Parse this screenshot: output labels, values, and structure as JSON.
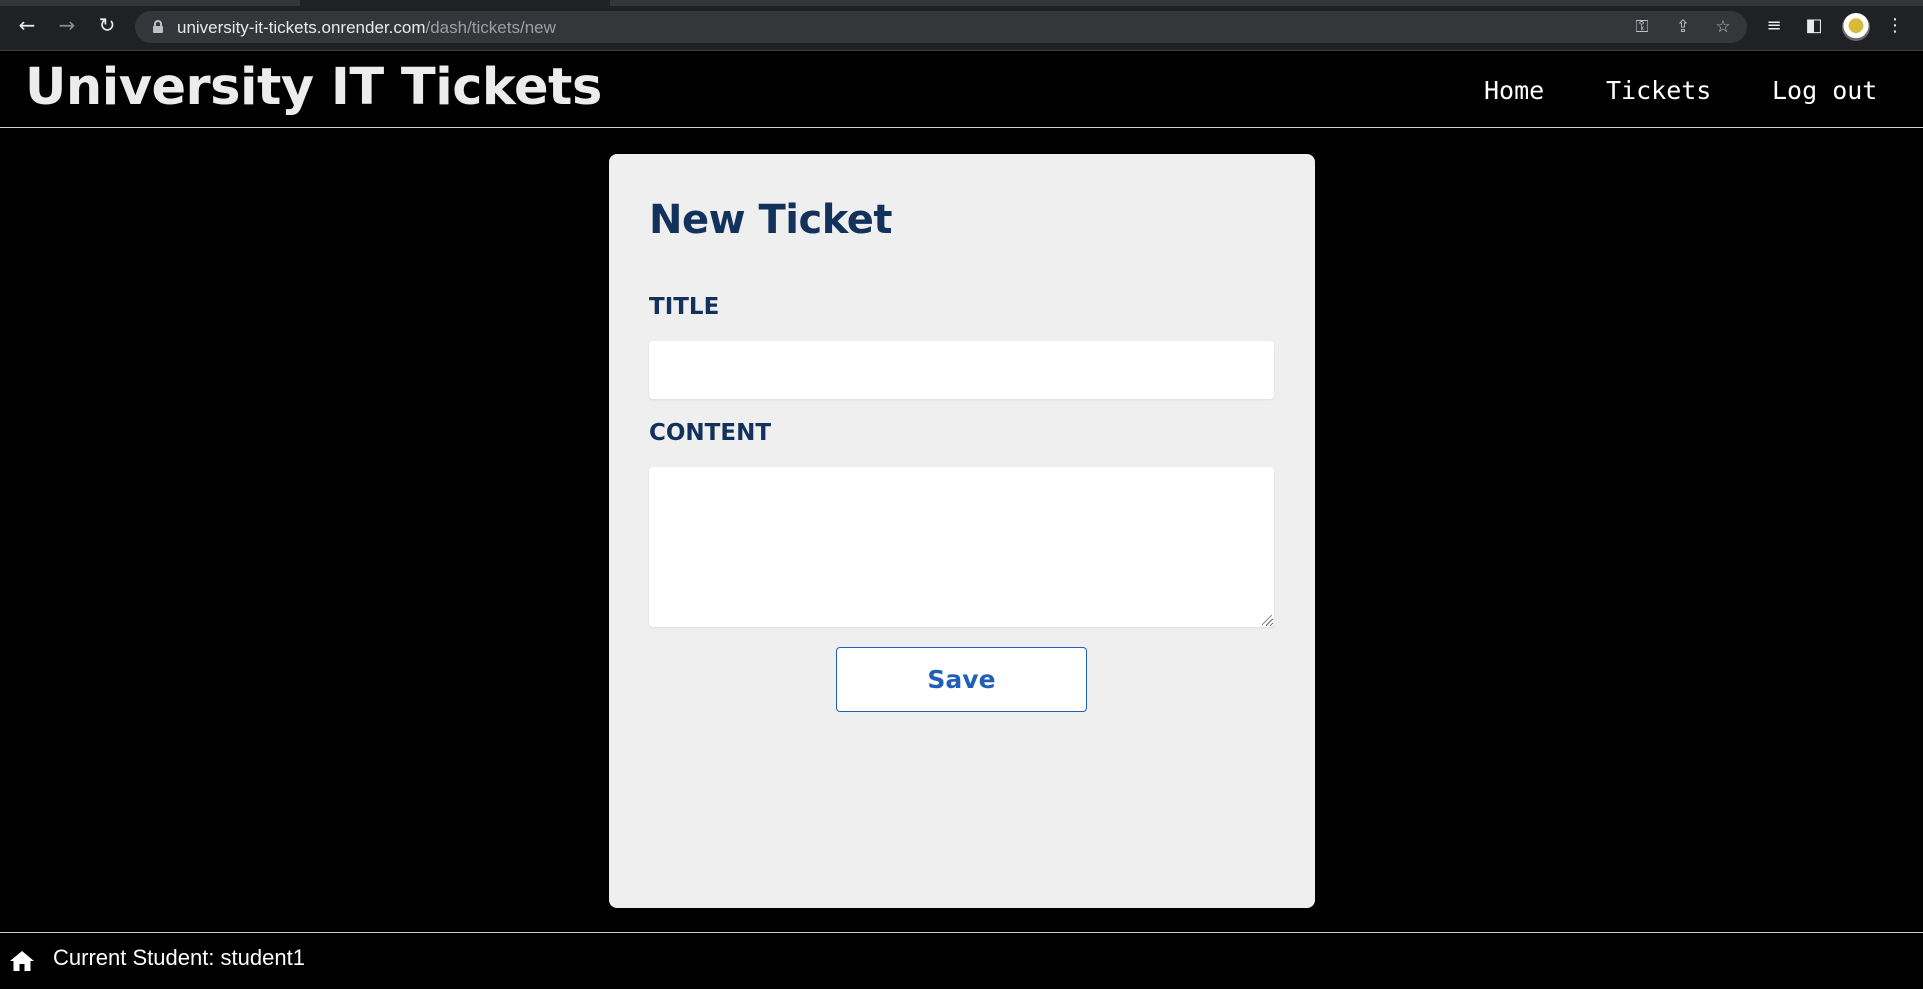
{
  "browser": {
    "url_host": "university-it-tickets.onrender.com",
    "url_path": "/dash/tickets/new",
    "icons": [
      "back-arrow-icon",
      "forward-arrow-icon",
      "reload-icon",
      "lock-icon",
      "key-icon",
      "share-icon",
      "star-icon",
      "reading-list-icon",
      "side-panel-icon",
      "profile-avatar",
      "kebab-menu-icon"
    ]
  },
  "header": {
    "title": "University IT Tickets",
    "nav": {
      "home": "Home",
      "tickets": "Tickets",
      "logout": "Log out"
    }
  },
  "form": {
    "heading": "New Ticket",
    "title_label": "TITLE",
    "title_value": "",
    "content_label": "CONTENT",
    "content_value": "",
    "save_label": "Save"
  },
  "footer": {
    "status": "Current Student: student1"
  },
  "colors": {
    "page_bg": "#000000",
    "card_bg": "#efefef",
    "heading": "#13325b",
    "accent": "#1f5fb7"
  }
}
